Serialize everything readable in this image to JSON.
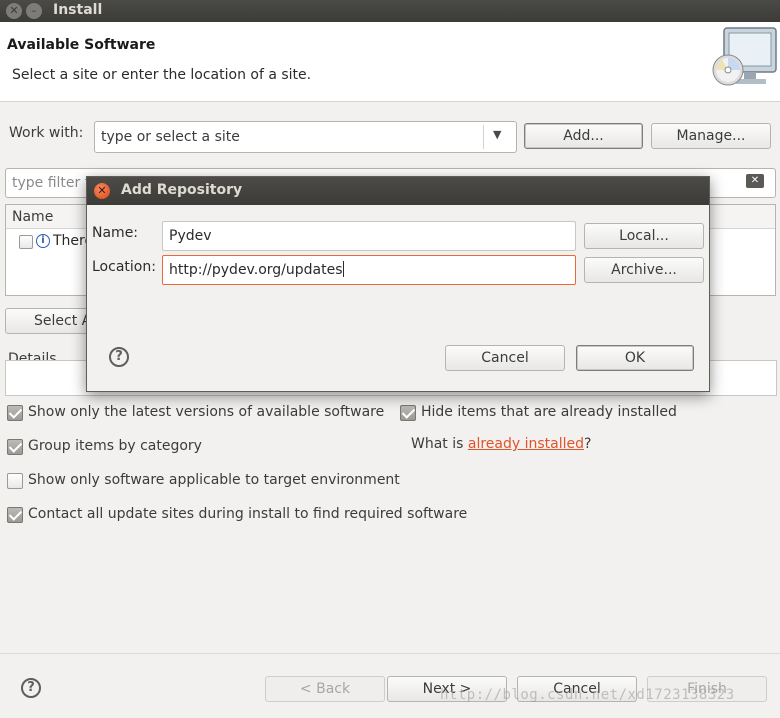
{
  "window": {
    "title": "Install"
  },
  "header": {
    "title": "Available Software",
    "subtitle": "Select a site or enter the location of a site."
  },
  "work_with": {
    "label": "Work with:",
    "placeholder": "type or select a site",
    "add_label": "Add...",
    "manage_label": "Manage..."
  },
  "filter": {
    "placeholder": "type filter t"
  },
  "table": {
    "column_name": "Name",
    "row_text": "There"
  },
  "select_all_label": "Select A",
  "details_label": "Details",
  "options": [
    {
      "label": "Show only the latest versions of available software",
      "checked": true
    },
    {
      "label": "Group items by category",
      "checked": true
    },
    {
      "label": "Show only software applicable to target environment",
      "checked": false
    },
    {
      "label": "Contact all update sites during install to find required software",
      "checked": true
    },
    {
      "label": "Hide items that are already installed",
      "checked": true
    }
  ],
  "what_is": {
    "prefix": "What is ",
    "link": "already installed",
    "suffix": "?"
  },
  "footer": {
    "back_label": "< Back",
    "next_label": "Next >",
    "cancel_label": "Cancel",
    "finish_label": "Finish"
  },
  "dialog": {
    "title": "Add Repository",
    "name_label": "Name:",
    "name_value": "Pydev",
    "location_label": "Location:",
    "location_value": "http://pydev.org/updates",
    "local_label": "Local...",
    "archive_label": "Archive...",
    "cancel_label": "Cancel",
    "ok_label": "OK"
  },
  "watermark": "http://blog.csdn.net/xd1723138323"
}
